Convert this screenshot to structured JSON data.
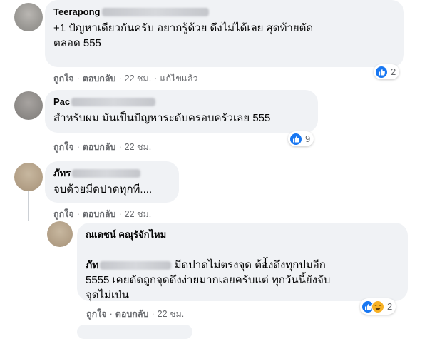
{
  "comments": [
    {
      "author": "Teerapong",
      "text": "+1 ปัญหาเดียวกันครับ อยากรู้ด้วย ดึงไม่ได้เลย สุดท้ายตัด\nตลอด 555",
      "actions": {
        "like": "ถูกใจ",
        "reply": "ตอบกลับ",
        "time": "22 ชม.",
        "edited": "แก้ไขแล้ว"
      },
      "reaction_count": "2"
    },
    {
      "author": "Pac",
      "text": "สำหรับผม มันเป็นปัญหาระดับครอบครัวเลย 555",
      "actions": {
        "like": "ถูกใจ",
        "reply": "ตอบกลับ",
        "time": "22 ชม."
      },
      "reaction_count": "9"
    },
    {
      "author": "ภัทร",
      "text": "จบด้วยมีดปาดทุกที....",
      "actions": {
        "like": "ถูกใจ",
        "reply": "ตอบกลับ",
        "time": "22 ชม."
      }
    },
    {
      "author": "ณเดชน์ คณุรัจักไหม",
      "tag": "ภัท",
      "text_line1": "มีดปาดไม่ตรงจุด ต้องดึงทุกปมอีก",
      "text_rest": "5555 เคยตัดถูกจุดดึงง่ายมากเลยครับแต่ ทุกวันนี้ยังจับ\nจุดไม่เป่น",
      "actions": {
        "like": "ถูกใจ",
        "reply": "ตอบกลับ",
        "time": "22 ชม."
      },
      "reaction_count": "2"
    }
  ],
  "colors": {
    "bubble": "#f0f2f5",
    "meta": "#65676b",
    "like_blue": "#1877f2",
    "haha_yellow": "#f7b125"
  },
  "icons": {
    "like": "thumbs-up-icon",
    "haha": "laughing-face-icon"
  }
}
